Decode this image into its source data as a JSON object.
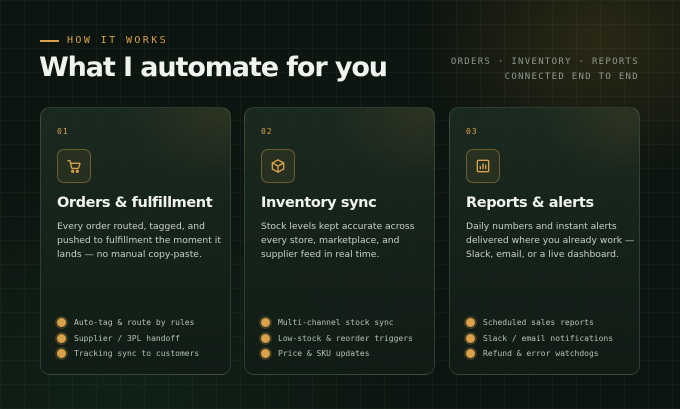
{
  "header": {
    "eyebrow": "HOW IT WORKS",
    "title": "What I automate for you",
    "tagline_line1": "ORDERS · INVENTORY · REPORTS",
    "tagline_line2": "CONNECTED END TO END"
  },
  "colors": {
    "accent": "#d9a24a",
    "background": "#0d1510",
    "card": "#16261d"
  },
  "cards": [
    {
      "number": "01",
      "icon": "shopping-cart-icon",
      "title": "Orders & fulfillment",
      "description": "Every order routed, tagged, and pushed to fulfillment the moment it lands — no manual copy-paste.",
      "items": [
        "Auto-tag & route by rules",
        "Supplier / 3PL handoff",
        "Tracking sync to customers"
      ]
    },
    {
      "number": "02",
      "icon": "box-icon",
      "title": "Inventory sync",
      "description": "Stock levels kept accurate across every store, marketplace, and supplier feed in real time.",
      "items": [
        "Multi-channel stock sync",
        "Low-stock & reorder triggers",
        "Price & SKU updates"
      ]
    },
    {
      "number": "03",
      "icon": "bar-chart-icon",
      "title": "Reports & alerts",
      "description": "Daily numbers and instant alerts delivered where you already work — Slack, email, or a live dashboard.",
      "items": [
        "Scheduled sales reports",
        "Slack / email notifications",
        "Refund & error watchdogs"
      ]
    }
  ]
}
